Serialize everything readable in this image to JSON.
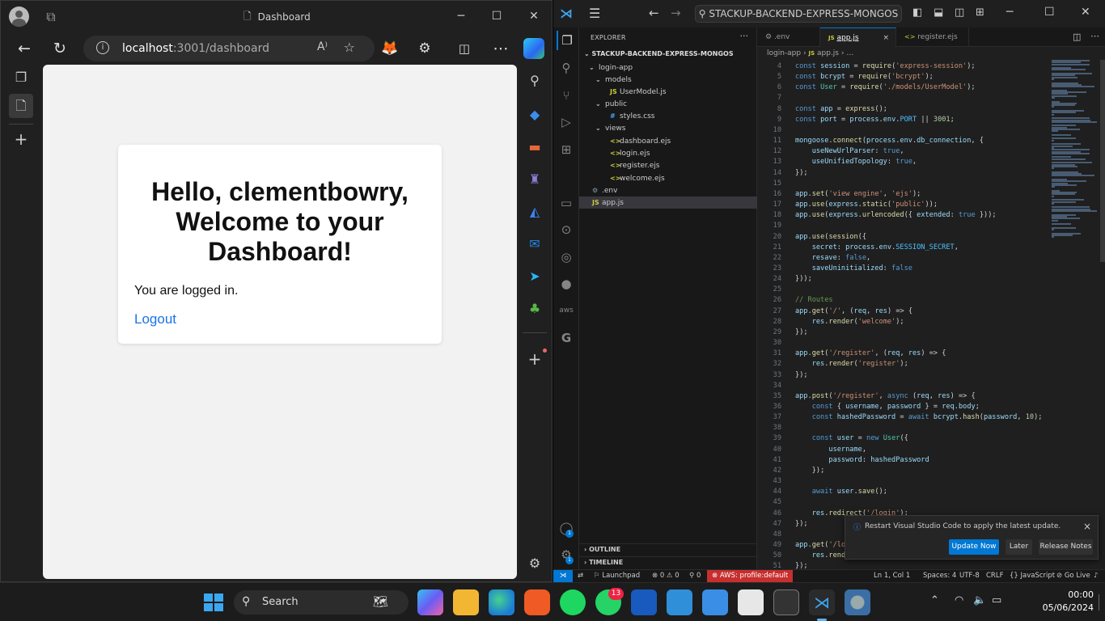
{
  "edge": {
    "tab_title": "Dashboard",
    "address_host": "localhost",
    "address_path": ":3001/dashboard",
    "read_aloud": "A⁾",
    "page": {
      "heading": "Hello, clementbowry, Welcome to your Dashboard!",
      "status_text": "You are logged in.",
      "logout_link": "Logout"
    }
  },
  "vscode": {
    "command_center": "STACKUP-BACKEND-EXPRESS-MONGOS",
    "explorer_title": "EXPLORER",
    "explorer_more": "···",
    "root_folder": "STACKUP-BACKEND-EXPRESS-MONGOS",
    "tree": [
      {
        "label": "login-app",
        "type": "folder"
      },
      {
        "label": "models",
        "type": "folder"
      },
      {
        "label": "UserModel.js",
        "type": "js"
      },
      {
        "label": "public",
        "type": "folder"
      },
      {
        "label": "styles.css",
        "type": "css"
      },
      {
        "label": "views",
        "type": "folder"
      },
      {
        "label": "dashboard.ejs",
        "type": "ejs"
      },
      {
        "label": "login.ejs",
        "type": "ejs"
      },
      {
        "label": "register.ejs",
        "type": "ejs"
      },
      {
        "label": "welcome.ejs",
        "type": "ejs"
      },
      {
        "label": ".env",
        "type": "env"
      },
      {
        "label": "app.js",
        "type": "js"
      }
    ],
    "outline": "OUTLINE",
    "timeline": "TIMELINE",
    "tabs": [
      {
        "label": ".env",
        "icon": "gear"
      },
      {
        "label": "app.js",
        "icon": "JS"
      },
      {
        "label": "register.ejs",
        "icon": "<>"
      }
    ],
    "tab_close": "×",
    "breadcrumb": [
      "login-app",
      "app.js"
    ],
    "first_line_number": 4,
    "code_lines": [
      "const session = require('express-session');",
      "const bcrypt = require('bcrypt');",
      "const User = require('./models/UserModel');",
      "",
      "const app = express();",
      "const port = process.env.PORT || 3001;",
      "",
      "mongoose.connect(process.env.db_connection, {",
      "    useNewUrlParser: true,",
      "    useUnifiedTopology: true,",
      "});",
      "",
      "app.set('view engine', 'ejs');",
      "app.use(express.static('public'));",
      "app.use(express.urlencoded({ extended: true }));",
      "",
      "app.use(session({",
      "    secret: process.env.SESSION_SECRET,",
      "    resave: false,",
      "    saveUninitialized: false",
      "}));",
      "",
      "// Routes",
      "app.get('/', (req, res) => {",
      "    res.render('welcome');",
      "});",
      "",
      "app.get('/register', (req, res) => {",
      "    res.render('register');",
      "});",
      "",
      "app.post('/register', async (req, res) => {",
      "    const { username, password } = req.body;",
      "    const hashedPassword = await bcrypt.hash(password, 10);",
      "",
      "    const user = new User({",
      "        username,",
      "        password: hashedPassword",
      "    });",
      "",
      "    await user.save();",
      "",
      "    res.redirect('/login');",
      "});",
      "",
      "app.get('/login', (req, res) => {",
      "    res.render('login');",
      "});"
    ],
    "notification": {
      "message": "Restart Visual Studio Code to apply the latest update.",
      "primary": "Update Now",
      "secondary": "Later",
      "tertiary": "Release Notes",
      "close": "×"
    },
    "status": {
      "launchpad": "Launchpad",
      "problems": "⊗ 0 ⚠ 0",
      "ports": "0",
      "aws": "AWS: profile:default",
      "position": "Ln 1, Col 1",
      "spaces": "Spaces: 4",
      "encoding": "UTF-8",
      "eol": "CRLF",
      "language": "JavaScript",
      "golive": "Go Live"
    },
    "accounts_badge": "1",
    "manage_badge": "1"
  },
  "taskbar": {
    "search_label": "Search",
    "whatsapp_badge": "13",
    "time": "00:00",
    "date": "05/06/2024"
  },
  "colors": {
    "accent": "#0078d4",
    "link": "#1a73e8",
    "aws_status": "#c72e2e"
  }
}
